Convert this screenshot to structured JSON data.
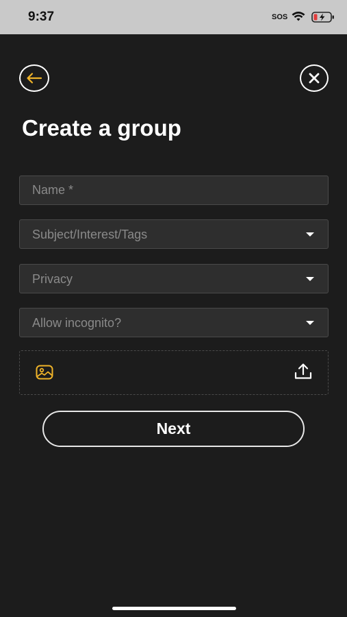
{
  "status_bar": {
    "time": "9:37",
    "sos": "SOS",
    "icons": [
      "wifi-icon",
      "battery-charging-icon"
    ]
  },
  "header": {
    "back_icon": "arrow-left-icon",
    "close_icon": "close-icon",
    "title": "Create a group"
  },
  "form": {
    "name": {
      "value": "",
      "placeholder": "Name *"
    },
    "subject": {
      "label": "Subject/Interest/Tags"
    },
    "privacy": {
      "label": "Privacy"
    },
    "incognito": {
      "label": "Allow incognito?"
    },
    "upload": {
      "image_icon": "image-icon",
      "upload_icon": "upload-icon"
    }
  },
  "actions": {
    "next_label": "Next"
  },
  "colors": {
    "background": "#1c1c1c",
    "field_bg": "#2e2e2e",
    "accent": "#f0b429",
    "text": "#ffffff",
    "placeholder": "#8a8a8a"
  }
}
